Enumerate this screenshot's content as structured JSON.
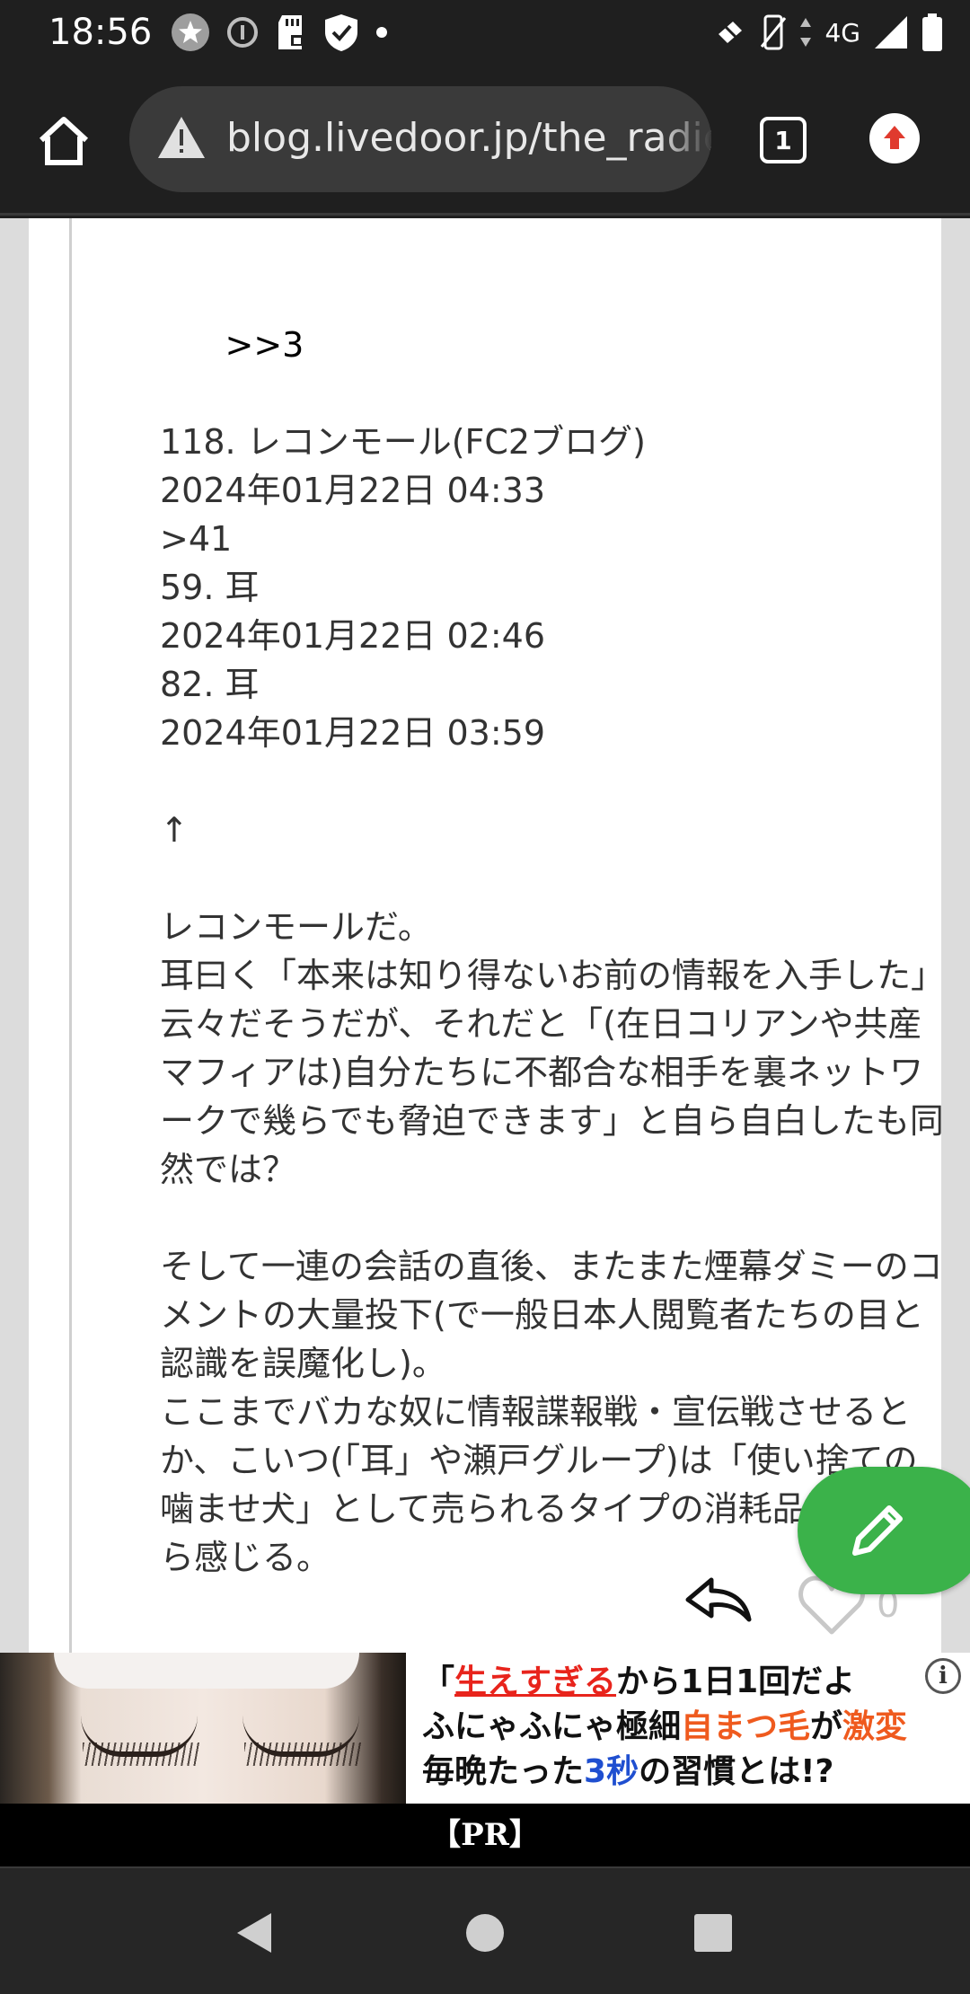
{
  "status_bar": {
    "time": "18:56",
    "network": "4G",
    "left_icons": [
      "star-badge-icon",
      "info-circle-icon",
      "sd-card-icon",
      "shield-check-icon",
      "dot-icon"
    ],
    "right_icons": [
      "mute-icon",
      "vibrate-icon",
      "signal-icon",
      "battery-icon"
    ]
  },
  "browser": {
    "url": "blog.livedoor.jp/the_radio",
    "tab_count": "1"
  },
  "comment": {
    "lines": [
      ">>3",
      "",
      "118. レコンモール(FC2ブログ)",
      "2024年01月22日 04:33",
      ">41",
      "59. 耳",
      "2024年01月22日 02:46",
      "82. 耳",
      "2024年01月22日 03:59",
      "",
      "↑",
      "",
      "レコンモールだ。",
      "耳曰く「本来は知り得ないお前の情報を入手した」云々だそうだが、それだと「(在日コリアンや共産マフィアは)自分たちに不都合な相手を裏ネットワークで幾らでも脅迫できます」と自ら自白したも同然では？",
      "",
      "そして一連の会話の直後、またまた煙幕ダミーのコメントの大量投下(で一般日本人閲覧者たちの目と認識を誤魔化し)。",
      "ここまでバカな奴に情報諜報戦・宣伝戦させるとか、こいつ(「耳」や瀬戸グループ)は「使い捨ての噛ませ犬」として売られるタイプの消耗品駒だとすら感じる。"
    ],
    "like_count": "0"
  },
  "ad": {
    "line1_a": "「",
    "line1_red": "生えすぎる",
    "line1_b": "から1日1回だよ",
    "line2_a": "ふにゃふにゃ極細",
    "line2_orange": "自まつ毛",
    "line2_b": "が",
    "line2_red": "激変",
    "line3_a": "毎晩たった",
    "line3_blue": "3秒",
    "line3_b": "の習慣とは!?",
    "info_glyph": "i",
    "pr_label": "【PR】"
  },
  "colors": {
    "fab": "#3bb24a",
    "background": "#1f1f1f"
  }
}
